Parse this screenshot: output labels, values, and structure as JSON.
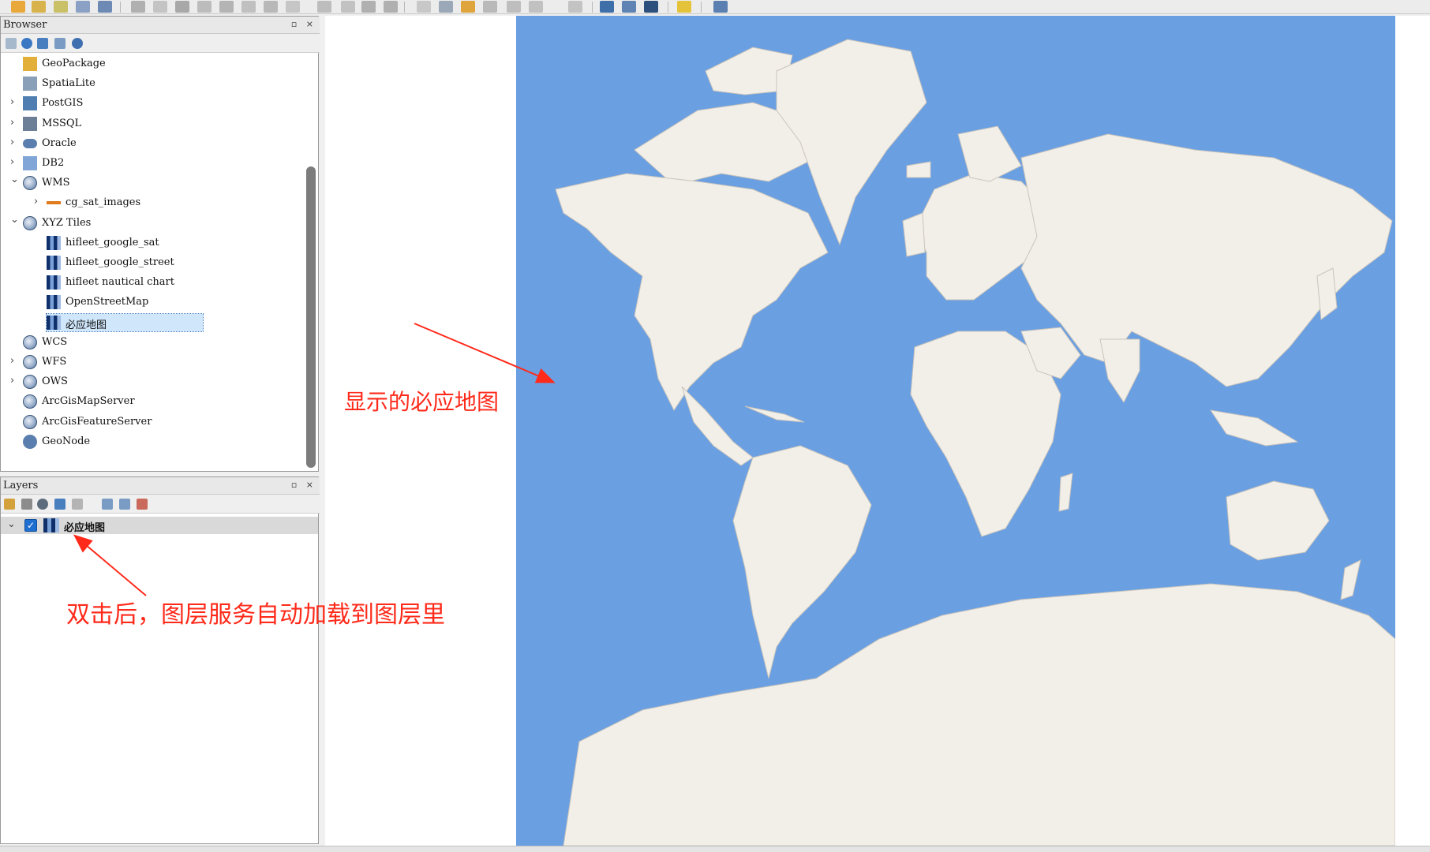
{
  "browser": {
    "title": "Browser",
    "items": [
      {
        "label": "GeoPackage",
        "icon": "geopackage-icon",
        "expandable": false,
        "expanded": false
      },
      {
        "label": "SpatiaLite",
        "icon": "spatialite-feather-icon",
        "expandable": false,
        "expanded": false
      },
      {
        "label": "PostGIS",
        "icon": "postgis-elephant-icon",
        "expandable": true,
        "expanded": false
      },
      {
        "label": "MSSQL",
        "icon": "mssql-icon",
        "expandable": true,
        "expanded": false
      },
      {
        "label": "Oracle",
        "icon": "oracle-icon",
        "expandable": true,
        "expanded": false
      },
      {
        "label": "DB2",
        "icon": "db2-icon",
        "expandable": true,
        "expanded": false
      },
      {
        "label": "WMS",
        "icon": "wms-globe-icon",
        "expandable": true,
        "expanded": true
      },
      {
        "label": "cg_sat_images",
        "icon": "connection-icon",
        "expandable": true,
        "expanded": false
      },
      {
        "label": "XYZ Tiles",
        "icon": "xyz-globe-icon",
        "expandable": true,
        "expanded": true
      },
      {
        "label": "hifleet_google_sat",
        "icon": "xyz-tile-icon",
        "expandable": false,
        "expanded": false
      },
      {
        "label": "hifleet_google_street",
        "icon": "xyz-tile-icon",
        "expandable": false,
        "expanded": false
      },
      {
        "label": "hifleet nautical chart",
        "icon": "xyz-tile-icon",
        "expandable": false,
        "expanded": false
      },
      {
        "label": "OpenStreetMap",
        "icon": "xyz-tile-icon",
        "expandable": false,
        "expanded": false
      },
      {
        "label": "必应地图",
        "icon": "xyz-tile-icon",
        "expandable": false,
        "expanded": false,
        "selected": true
      },
      {
        "label": "WCS",
        "icon": "wcs-globe-icon",
        "expandable": false,
        "expanded": false
      },
      {
        "label": "WFS",
        "icon": "wfs-globe-icon",
        "expandable": true,
        "expanded": false
      },
      {
        "label": "OWS",
        "icon": "ows-globe-icon",
        "expandable": true,
        "expanded": false
      },
      {
        "label": "ArcGisMapServer",
        "icon": "arcgis-map-globe-icon",
        "expandable": false,
        "expanded": false
      },
      {
        "label": "ArcGisFeatureServer",
        "icon": "arcgis-feature-globe-icon",
        "expandable": false,
        "expanded": false
      },
      {
        "label": "GeoNode",
        "icon": "geonode-icon",
        "expandable": false,
        "expanded": false
      }
    ]
  },
  "layers": {
    "title": "Layers",
    "items": [
      {
        "label": "必应地图",
        "checked": true,
        "icon": "xyz-tile-icon"
      }
    ]
  },
  "annotations": {
    "map_label": "显示的必应地图",
    "layers_label": "双击后，图层服务自动加载到图层里"
  },
  "colors": {
    "ocean": "#6a9fe2",
    "land": "#f2efe9",
    "annotation": "#ff2a1a",
    "selection": "#cfe6fb"
  }
}
